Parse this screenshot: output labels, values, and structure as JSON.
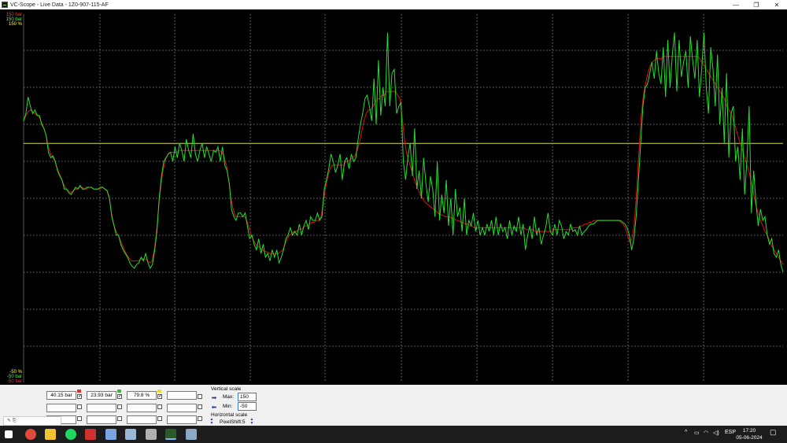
{
  "window": {
    "title": "VC-Scope  -  Live Data  -  1Z0-907-115-AF",
    "minimize_glyph": "—",
    "maximize_glyph": "❐",
    "close_glyph": "✕"
  },
  "scope": {
    "top_labels": [
      {
        "text": "150 bar",
        "color": "#ff3030"
      },
      {
        "text": "150 bar",
        "color": "#40ff40"
      },
      {
        "text": "150 %",
        "color": "#ffff40"
      }
    ],
    "bottom_labels": [
      {
        "text": "-50 %",
        "color": "#ffff40"
      },
      {
        "text": "-50 bar",
        "color": "#40ff40"
      },
      {
        "text": "-50 bar",
        "color": "#ff3030"
      }
    ],
    "y_range": [
      -50,
      150
    ],
    "colors": {
      "background": "#000000",
      "grid": "#9a9a9a",
      "red_trace": "#e01010",
      "green_trace": "#22e02a",
      "yellow_trace": "#d8d850"
    },
    "yellow_level": 79.8,
    "green_series": [
      92,
      96,
      105,
      100,
      96,
      98,
      95,
      95,
      90,
      88,
      84,
      75,
      72,
      73,
      70,
      65,
      62,
      60,
      55,
      55,
      53,
      52,
      54,
      56,
      55,
      57,
      55,
      55,
      56,
      56,
      56,
      55,
      55,
      55,
      56,
      56,
      55,
      54,
      50,
      40,
      35,
      30,
      30,
      25,
      22,
      20,
      18,
      15,
      13,
      12,
      14,
      15,
      18,
      16,
      20,
      15,
      12,
      14,
      22,
      32,
      50,
      62,
      70,
      72,
      74,
      75,
      70,
      78,
      72,
      80,
      76,
      70,
      82,
      76,
      72,
      85,
      74,
      70,
      76,
      80,
      72,
      78,
      74,
      70,
      76,
      75,
      78,
      70,
      78,
      68,
      65,
      58,
      44,
      40,
      38,
      42,
      42,
      40,
      42,
      35,
      28,
      30,
      25,
      22,
      28,
      20,
      25,
      18,
      20,
      16,
      22,
      18,
      22,
      15,
      18,
      22,
      28,
      30,
      34,
      30,
      32,
      30,
      36,
      30,
      35,
      38,
      33,
      40,
      38,
      38,
      42,
      38,
      40,
      55,
      60,
      66,
      74,
      70,
      64,
      68,
      74,
      60,
      70,
      72,
      66,
      74,
      70,
      72,
      82,
      90,
      96,
      104,
      106,
      100,
      92,
      115,
      90,
      125,
      95,
      110,
      100,
      140,
      100,
      118,
      120,
      96,
      100,
      102,
      70,
      60,
      72,
      80,
      62,
      88,
      55,
      65,
      50,
      72,
      58,
      48,
      62,
      55,
      40,
      70,
      38,
      52,
      42,
      60,
      35,
      50,
      30,
      55,
      40,
      45,
      32,
      50,
      30,
      38,
      35,
      42,
      32,
      38,
      30,
      34,
      30,
      36,
      32,
      38,
      30,
      40,
      30,
      36,
      32,
      34,
      28,
      38,
      30,
      35,
      32,
      40,
      30,
      36,
      22,
      30,
      35,
      28,
      40,
      30,
      34,
      25,
      30,
      34,
      42,
      32,
      30,
      36,
      30,
      38,
      35,
      28,
      32,
      30,
      36,
      32,
      33,
      30,
      35,
      30,
      32,
      33,
      35,
      36,
      36,
      37,
      38,
      38,
      38,
      38,
      38,
      38,
      38,
      38,
      38,
      38,
      38,
      37,
      36,
      34,
      30,
      22,
      28,
      40,
      60,
      80,
      100,
      110,
      112,
      118,
      124,
      115,
      130,
      118,
      112,
      132,
      105,
      136,
      110,
      128,
      140,
      108,
      136,
      116,
      124,
      130,
      110,
      138,
      125,
      115,
      136,
      105,
      120,
      140,
      110,
      96,
      132,
      120,
      100,
      128,
      90,
      110,
      80,
      118,
      72,
      96,
      100,
      70,
      78,
      60,
      88,
      52,
      70,
      100,
      42,
      65,
      48,
      35,
      44,
      38,
      40,
      30,
      25,
      28,
      20,
      18,
      22,
      14,
      10
    ],
    "red_series": [
      92,
      95,
      97,
      98,
      97,
      96,
      95,
      94,
      91,
      88,
      84,
      78,
      74,
      72,
      70,
      66,
      63,
      60,
      57,
      55,
      54,
      53,
      54,
      55,
      55,
      56,
      56,
      55,
      55,
      56,
      56,
      55,
      55,
      55,
      55,
      56,
      55,
      54,
      50,
      42,
      36,
      32,
      30,
      27,
      24,
      21,
      19,
      17,
      16,
      16,
      16,
      16,
      17,
      17,
      17,
      16,
      15,
      16,
      22,
      32,
      46,
      58,
      66,
      71,
      74,
      75,
      75,
      75,
      75,
      76,
      76,
      76,
      76,
      76,
      76,
      76,
      76,
      76,
      76,
      76,
      76,
      76,
      76,
      76,
      76,
      76,
      76,
      76,
      75,
      72,
      68,
      60,
      50,
      44,
      40,
      40,
      40,
      40,
      40,
      38,
      34,
      30,
      27,
      25,
      24,
      23,
      22,
      21,
      21,
      20,
      20,
      20,
      20,
      20,
      21,
      22,
      25,
      28,
      30,
      31,
      32,
      32,
      33,
      33,
      34,
      35,
      35,
      36,
      37,
      37,
      38,
      38,
      40,
      48,
      56,
      62,
      66,
      68,
      68,
      68,
      68,
      68,
      68,
      70,
      70,
      71,
      72,
      73,
      76,
      80,
      86,
      92,
      96,
      98,
      98,
      100,
      102,
      104,
      104,
      106,
      106,
      108,
      108,
      108,
      108,
      108,
      106,
      104,
      94,
      82,
      74,
      70,
      66,
      62,
      58,
      55,
      52,
      50,
      48,
      47,
      46,
      45,
      44,
      43,
      42,
      41,
      41,
      40,
      40,
      40,
      39,
      39,
      38,
      38,
      37,
      37,
      36,
      36,
      35,
      35,
      34,
      34,
      34,
      34,
      34,
      34,
      34,
      34,
      34,
      34,
      34,
      34,
      34,
      34,
      34,
      34,
      34,
      34,
      34,
      34,
      34,
      34,
      34,
      33,
      33,
      33,
      33,
      32,
      32,
      32,
      32,
      32,
      32,
      32,
      32,
      33,
      33,
      33,
      33,
      33,
      33,
      33,
      33,
      33,
      34,
      34,
      34,
      35,
      35,
      36,
      36,
      37,
      37,
      38,
      38,
      38,
      38,
      38,
      38,
      38,
      38,
      38,
      38,
      38,
      38,
      37,
      36,
      34,
      30,
      26,
      28,
      36,
      54,
      74,
      94,
      106,
      112,
      118,
      122,
      124,
      125,
      126,
      126,
      126,
      127,
      127,
      127,
      127,
      127,
      127,
      127,
      127,
      127,
      127,
      127,
      127,
      127,
      127,
      127,
      127,
      126,
      124,
      122,
      120,
      118,
      116,
      114,
      112,
      110,
      108,
      106,
      104,
      100,
      98,
      96,
      92,
      88,
      84,
      80,
      76,
      72,
      68,
      64,
      58,
      52,
      46,
      42,
      38,
      35,
      32,
      30,
      27,
      24,
      22,
      20,
      18,
      16,
      14
    ]
  },
  "readouts": [
    {
      "value": "40.15 bar",
      "swatch": "#e03030",
      "checked": true
    },
    {
      "value": "23.93 bar",
      "swatch": "#30c030",
      "checked": true
    },
    {
      "value": "79.8 %",
      "swatch": "#e8e030",
      "checked": true
    },
    {
      "value": "",
      "swatch": "",
      "checked": false
    }
  ],
  "empty_rows": [
    [
      "",
      "",
      "",
      ""
    ],
    [
      "",
      "",
      "",
      ""
    ]
  ],
  "vertical_scale": {
    "label": "Vertical scale",
    "max_label": "Max:",
    "max_value": "150",
    "min_label": "Min:",
    "min_value": "-50"
  },
  "horizontal_scale": {
    "label": "Horizontal scale",
    "pixelshift_label": "PixelShift:5"
  },
  "mini_tool": "✎ ⎘",
  "taskbar": {
    "icons": [
      {
        "name": "windows-start-icon",
        "color": "#ffffff"
      },
      {
        "name": "chrome-icon",
        "color": "#e04a3a"
      },
      {
        "name": "file-explorer-icon",
        "color": "#f2c230"
      },
      {
        "name": "spotify-icon",
        "color": "#1ed760"
      },
      {
        "name": "app-red-icon",
        "color": "#d03030"
      },
      {
        "name": "app-window-icon",
        "color": "#7aa6e0"
      },
      {
        "name": "app-tools-icon",
        "color": "#9ab8d8"
      },
      {
        "name": "app-cable-icon",
        "color": "#b0b0b0"
      },
      {
        "name": "vc-scope-icon",
        "color": "#2a5a2a"
      },
      {
        "name": "app-wrench-icon",
        "color": "#8aa8c8"
      }
    ],
    "language": "ESP",
    "time": "17:20",
    "date": "05-06-2024"
  }
}
